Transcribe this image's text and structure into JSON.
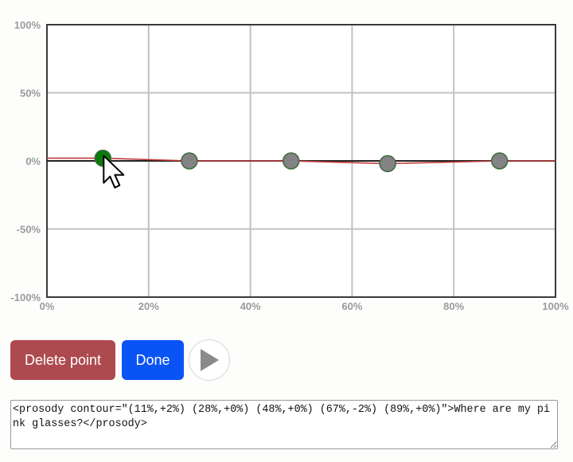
{
  "chart_data": {
    "type": "line",
    "x_ticks": [
      "0%",
      "20%",
      "40%",
      "60%",
      "80%",
      "100%"
    ],
    "y_ticks": [
      "100%",
      "50%",
      "0%",
      "-50%",
      "-100%"
    ],
    "xlim": [
      0,
      100
    ],
    "ylim": [
      -100,
      100
    ],
    "grid": true,
    "points": [
      {
        "x": 11,
        "y": 2,
        "selected": true
      },
      {
        "x": 28,
        "y": 0,
        "selected": false
      },
      {
        "x": 48,
        "y": 0,
        "selected": false
      },
      {
        "x": 67,
        "y": -2,
        "selected": false
      },
      {
        "x": 89,
        "y": 0,
        "selected": false
      }
    ]
  },
  "colors": {
    "selected_point": "#0b7a0b",
    "point": "#838383",
    "point_stroke": "#3f6b3f",
    "curve": "#c03a3a",
    "baseline": "#222222",
    "grid": "#c2c2c2",
    "delete_button": "#ad4a4f",
    "done_button": "#0a54f5"
  },
  "cursor_icon": "mouse-pointer-icon",
  "controls": {
    "delete_label": "Delete point",
    "done_label": "Done",
    "play_icon": "play-icon"
  },
  "ssml": {
    "text": "<prosody contour=\"(11%,+2%) (28%,+0%) (48%,+0%) (67%,-2%) (89%,+0%)\">Where are my pink glasses?</prosody>"
  }
}
